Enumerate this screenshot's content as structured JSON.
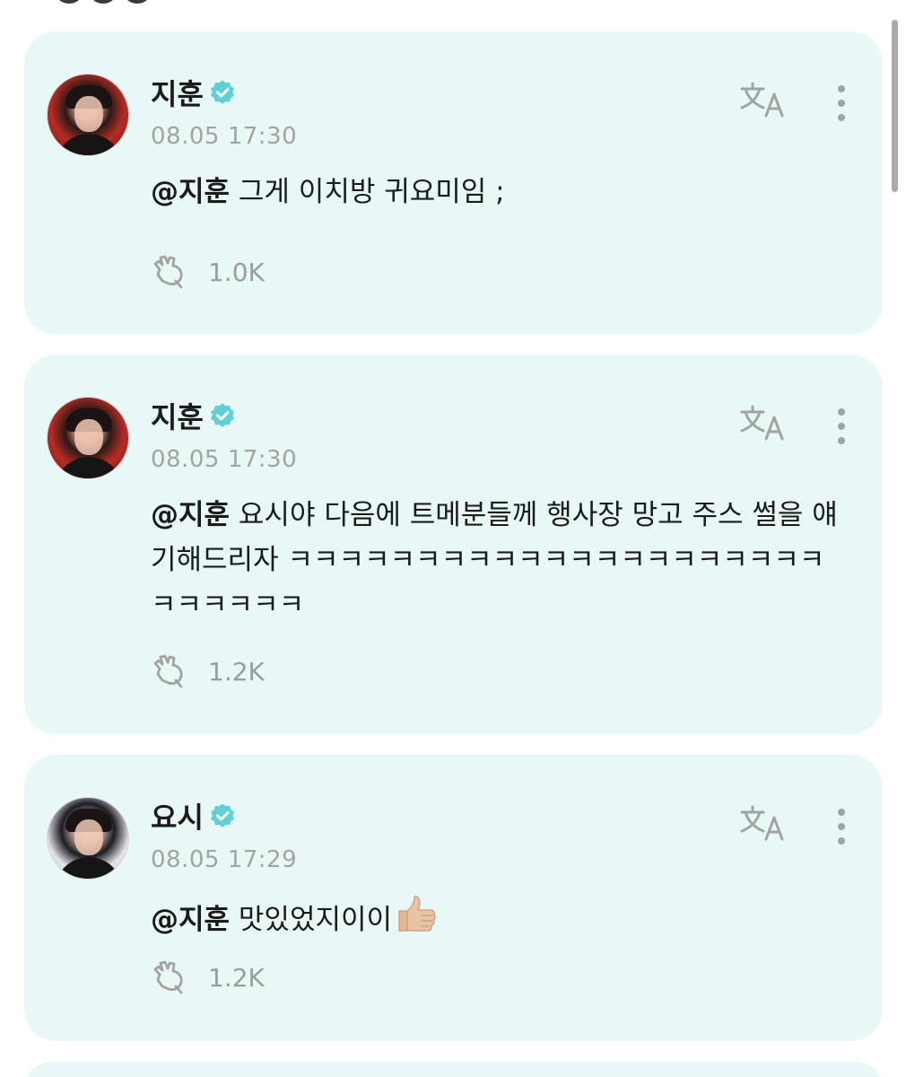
{
  "posts": [
    {
      "author": "지훈",
      "avatar_icon": "jihoon-avatar",
      "verified": true,
      "timestamp": "08.05 17:30",
      "mention": "@지훈",
      "text": " 그게 이치방 귀요미임 ;",
      "emoji": "",
      "likes": "1.0K"
    },
    {
      "author": "지훈",
      "avatar_icon": "jihoon-avatar",
      "verified": true,
      "timestamp": "08.05 17:30",
      "mention": "@지훈",
      "text": " 요시야 다음에 트메분들께 행사장 망고 주스 썰을 얘기해드리자 ㅋㅋㅋㅋㅋㅋㅋㅋㅋㅋㅋㅋㅋㅋㅋㅋㅋㅋㅋㅋㅋㅋㅋㅋㅋㅋㅋ",
      "emoji": "",
      "likes": "1.2K"
    },
    {
      "author": "요시",
      "avatar_icon": "yoshi-avatar",
      "verified": true,
      "timestamp": "08.05 17:29",
      "mention": "@지훈",
      "text": " 맛있었지이이",
      "emoji": "thumbs-up-icon",
      "likes": "1.2K"
    }
  ],
  "colors": {
    "card_background": "#e8f8f6",
    "verified_badge": "#5fd0d6",
    "timestamp": "#a3a3a3",
    "icon_gray": "#a3a3a3"
  }
}
